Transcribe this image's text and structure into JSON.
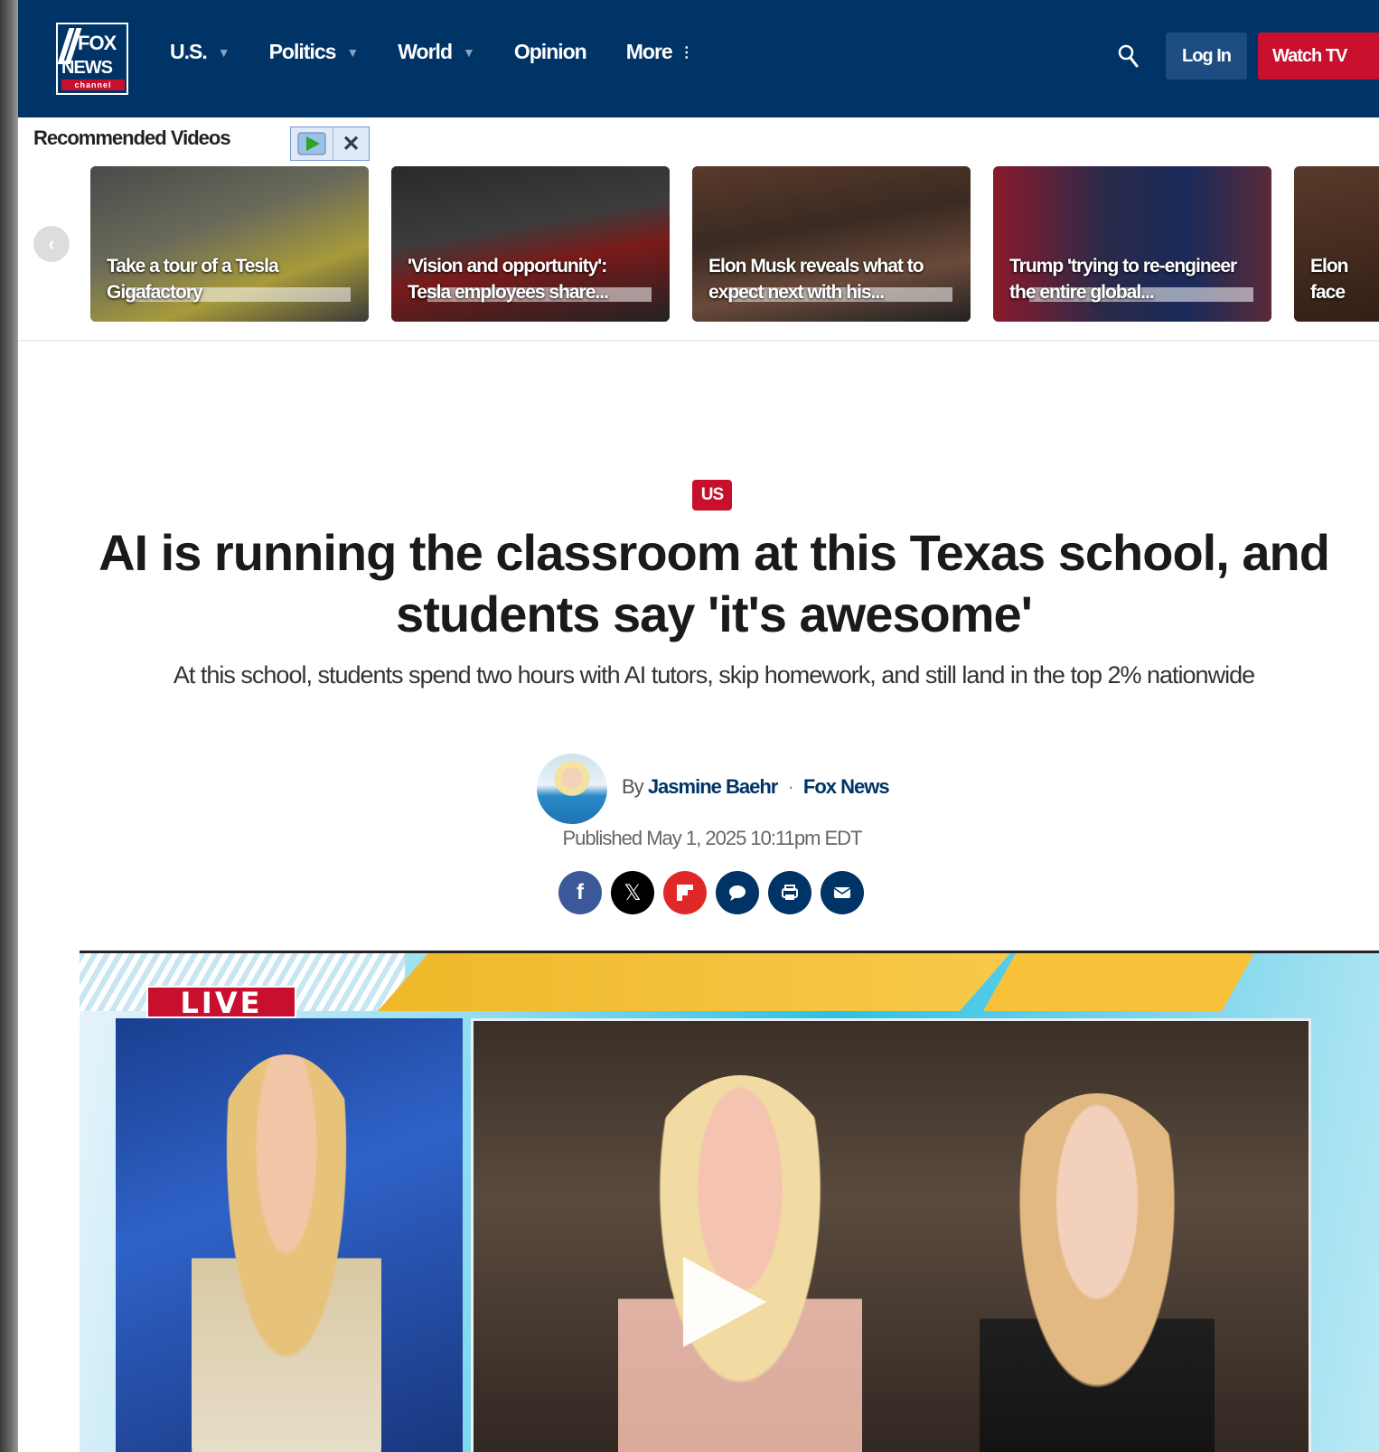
{
  "nav": {
    "logo": {
      "line1": "FOX",
      "line2": "NEWS",
      "line3": "channel"
    },
    "links": [
      {
        "label": "U.S.",
        "has_caret": true
      },
      {
        "label": "Politics",
        "has_caret": true
      },
      {
        "label": "World",
        "has_caret": true
      },
      {
        "label": "Opinion",
        "has_caret": false
      },
      {
        "label": "More",
        "has_caret": false
      }
    ],
    "login_label": "Log In",
    "watch_label": "Watch TV"
  },
  "recommended": {
    "title": "Recommended Videos",
    "cards": [
      {
        "label": "Take a tour of a Tesla Gigafactory"
      },
      {
        "label": "'Vision and opportunity': Tesla employees share..."
      },
      {
        "label": "Elon Musk reveals what to expect next with his..."
      },
      {
        "label": "Trump 'trying to re-engineer the entire global..."
      },
      {
        "label": "Elon face"
      }
    ]
  },
  "article": {
    "tag": "US",
    "headline": "AI is running the classroom at this Texas school, and students say 'it's awesome'",
    "dek": "At this school, students spend two hours with AI tutors, skip homework, and still land in the top 2% nationwide",
    "by": "By",
    "author": "Jasmine Baehr",
    "separator": "·",
    "org": "Fox News",
    "published": "Published May 1, 2025 10:11pm EDT"
  },
  "share": [
    {
      "name": "facebook",
      "color": "#3b5998"
    },
    {
      "name": "x",
      "color": "#000000"
    },
    {
      "name": "flipboard",
      "color": "#e12828"
    },
    {
      "name": "comments",
      "color": "#003366"
    },
    {
      "name": "print",
      "color": "#003366"
    },
    {
      "name": "email",
      "color": "#003366"
    }
  ],
  "video": {
    "live_label": "LIVE"
  }
}
